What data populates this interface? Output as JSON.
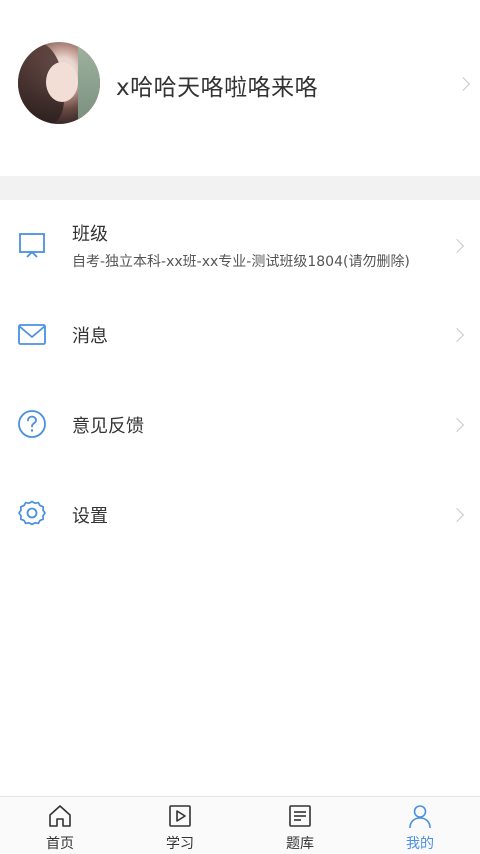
{
  "profile": {
    "name": "x哈哈天咯啦咯来咯"
  },
  "menu": {
    "class": {
      "title": "班级",
      "subtitle": "自考-独立本科-xx班-xx专业-测试班级1804(请勿删除)",
      "icon": "classroom-board-icon"
    },
    "messages": {
      "title": "消息",
      "icon": "mail-icon"
    },
    "feedback": {
      "title": "意见反馈",
      "icon": "question-circle-icon"
    },
    "settings": {
      "title": "设置",
      "icon": "gear-icon"
    }
  },
  "tabbar": {
    "tabs": [
      {
        "label": "首页",
        "icon": "home-icon"
      },
      {
        "label": "学习",
        "icon": "play-icon"
      },
      {
        "label": "题库",
        "icon": "document-icon"
      },
      {
        "label": "我的",
        "icon": "user-icon",
        "active": true
      }
    ]
  },
  "colors": {
    "accent": "#4a90e2",
    "icon_blue": "#4a90e2",
    "divider": "#f2f2f2"
  }
}
